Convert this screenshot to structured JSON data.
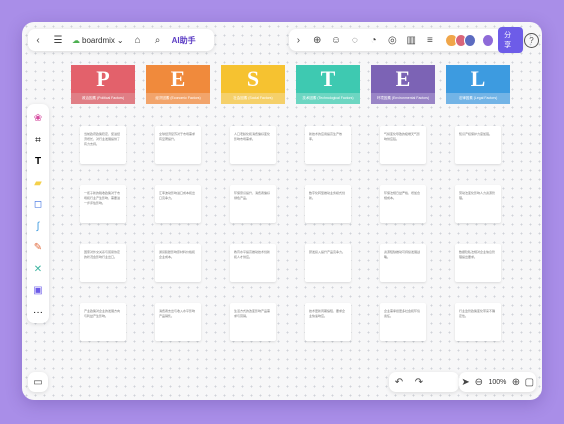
{
  "app": {
    "brand": "boardmix",
    "ai_label": "AI助手",
    "share_label": "分享",
    "help_label": "?"
  },
  "zoom": {
    "value": "100%"
  },
  "columns": [
    {
      "letter": "P",
      "subtitle": "政治因素 (Political Factors)",
      "color": "#e3616b",
      "subcolor": "#e07e85",
      "cards": [
        "当前政府政策稳定，促进经济增长，对行业发展提供了有力支持。",
        "一揽子新的税收政策对于市场和行业产生影响，需要进一步评估影响。",
        "国家对外交关系与贸易协定的状况会影响行业出口。",
        "产业政策对企业的发展方向与利益产生影响。"
      ]
    },
    {
      "letter": "E",
      "subtitle": "经济因素 (Economic Factors)",
      "color": "#f08a3c",
      "subcolor": "#f2a46b",
      "cards": [
        "全球经济复苏对于市场需求有显著提升。",
        "汇率波动影响进口成本和出口竞争力。",
        "通货膨胀影响原材料价格和企业成本。",
        "消费者支出与收入水平影响产品销售。"
      ]
    },
    {
      "letter": "S",
      "subtitle": "社会因素 (Social Factors)",
      "color": "#f6c230",
      "subcolor": "#f5d06a",
      "cards": [
        "人口老龄化和消费偏好变化影响市场需求。",
        "环保意识提升，消费者偏好绿色产品。",
        "教育水平提高推动技术创新和人才供应。",
        "生活方式的改变影响产品需求与营销。"
      ]
    },
    {
      "letter": "T",
      "subtitle": "技术因素 (Technological Factors)",
      "color": "#3ec9b1",
      "subcolor": "#6dd6c2",
      "cards": [
        "新技术的应用提高生产效率。",
        "数字化转型推动业务模式创新。",
        "研发投入提升产品竞争力。",
        "技术更新周期缩短，要求企业快速响应。"
      ]
    },
    {
      "letter": "E",
      "subtitle": "环境因素 (Environmental Factors)",
      "color": "#7c63b5",
      "subcolor": "#9984c6",
      "cards": [
        "气候变化导致的极端天气影响供应链。",
        "环保法规日益严格，增加合规成本。",
        "资源短缺推动可持续发展战略。",
        "企业需承担更多社会和环境责任。"
      ]
    },
    {
      "letter": "L",
      "subtitle": "法律因素 (Legal Factors)",
      "color": "#3d9be0",
      "subcolor": "#73b4e6",
      "cards": [
        "知识产权保护力度加强。",
        "劳动法变化影响人力资源管理。",
        "数据隐私法规对企业信息管理提出要求。",
        "行业监管政策变化带来不确定性。"
      ]
    }
  ]
}
